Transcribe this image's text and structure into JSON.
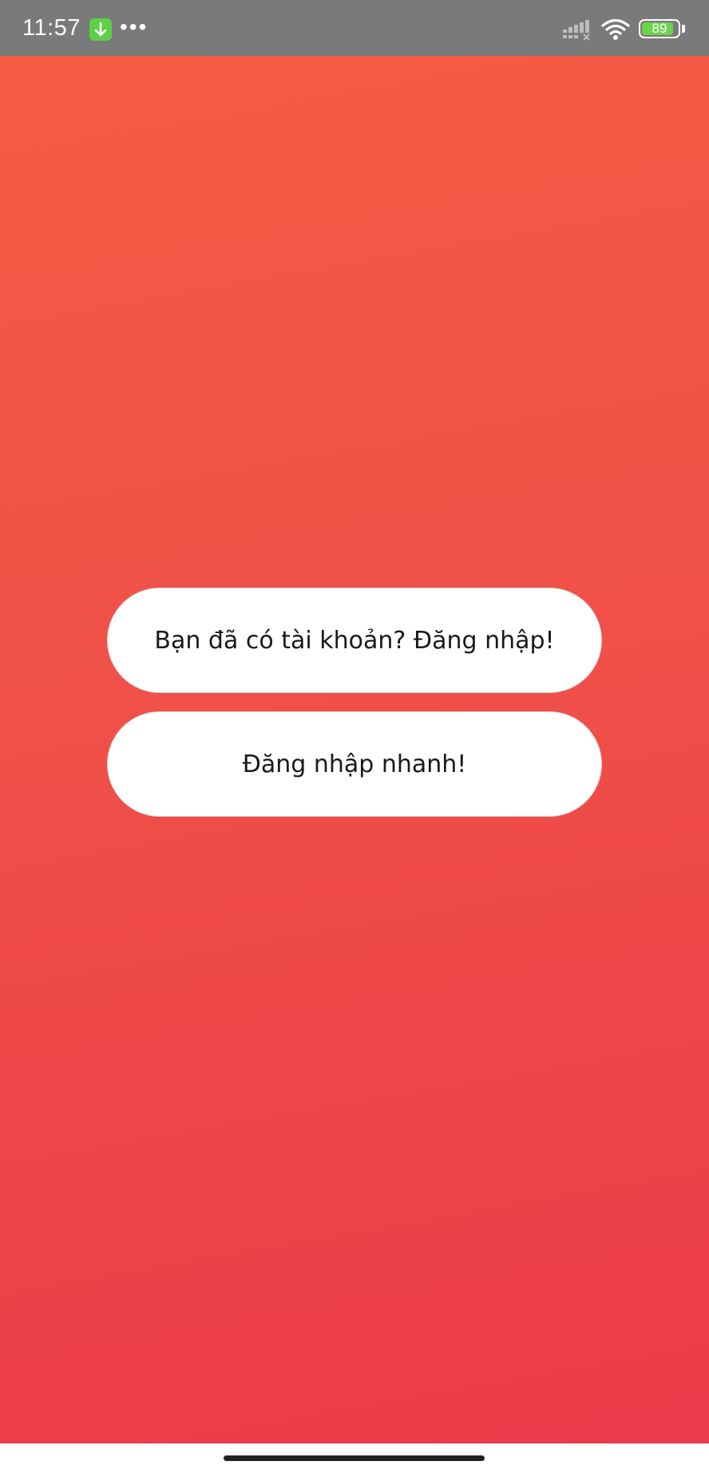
{
  "status_bar": {
    "time": "11:57",
    "more_indicator": "•••",
    "battery_level": "89",
    "battery_fraction": 0.89,
    "icons": [
      "download-app-icon",
      "signal-icon",
      "wifi-icon",
      "battery-icon"
    ],
    "background_color": "#7a7a7a"
  },
  "main": {
    "gradient_colors": [
      "#f45c44",
      "#f05048",
      "#eb3a4a"
    ],
    "login_button_label": "Bạn đã có tài khoản? Đăng nhập!",
    "quick_login_button_label": "Đăng nhập nhanh!"
  }
}
